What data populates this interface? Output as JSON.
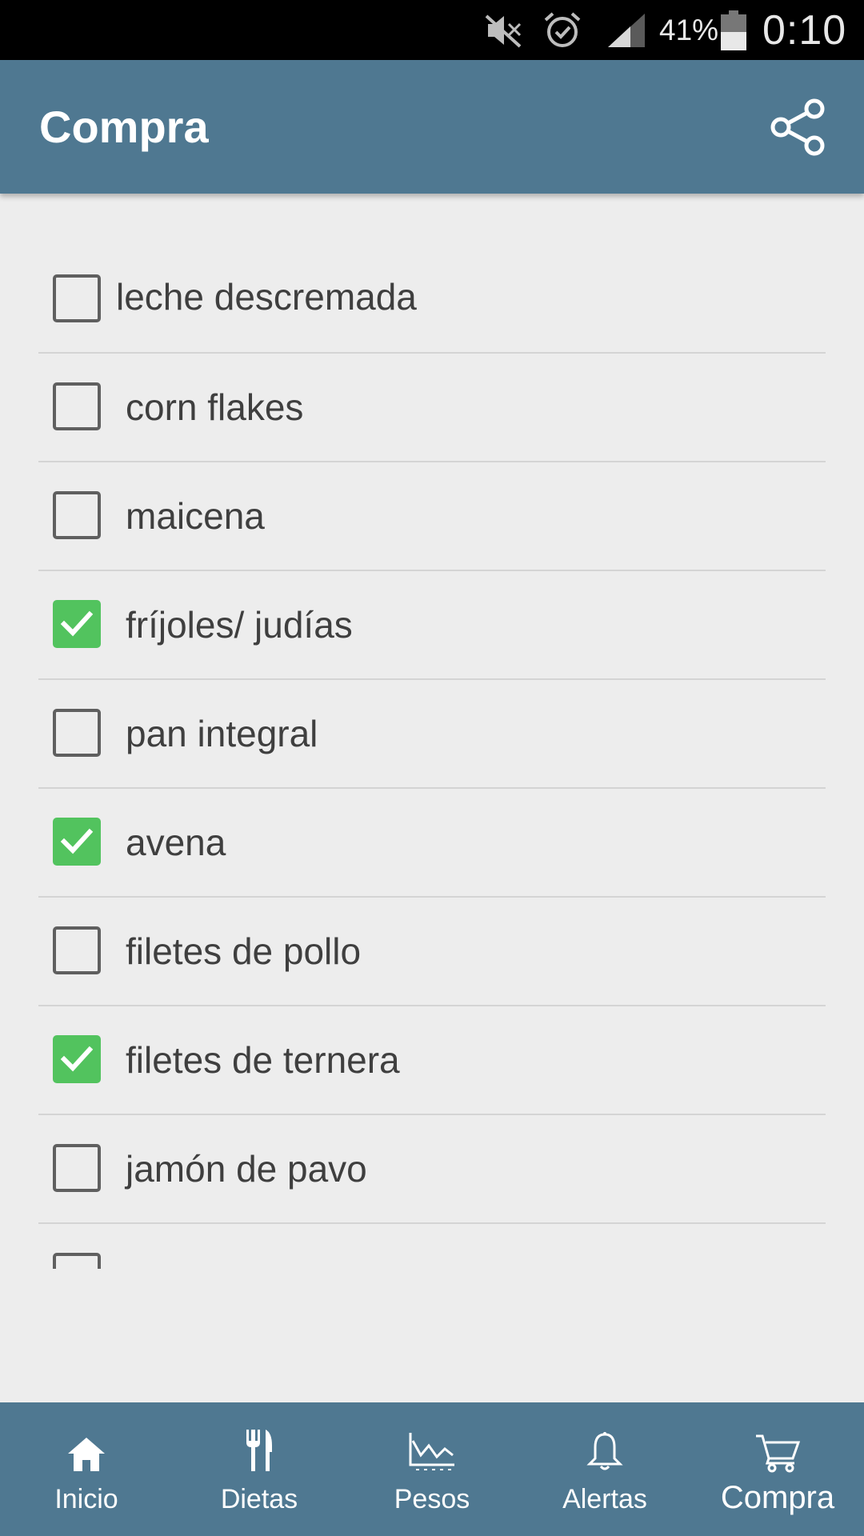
{
  "status_bar": {
    "battery_percent": "41%",
    "time": "0:10",
    "icons": [
      "mute-icon",
      "alarm-icon",
      "signal-icon",
      "battery-icon"
    ]
  },
  "app_bar": {
    "title": "Compra",
    "share_icon": "share-icon"
  },
  "shopping_list": {
    "items": [
      {
        "label": "leche descremada",
        "checked": false
      },
      {
        "label": "corn flakes",
        "checked": false
      },
      {
        "label": "maicena",
        "checked": false
      },
      {
        "label": "fríjoles/ judías",
        "checked": true
      },
      {
        "label": "pan integral",
        "checked": false
      },
      {
        "label": "avena",
        "checked": true
      },
      {
        "label": "filetes de pollo",
        "checked": false
      },
      {
        "label": "filetes de ternera",
        "checked": true
      },
      {
        "label": "jamón de pavo",
        "checked": false
      },
      {
        "label": "",
        "checked": false
      }
    ]
  },
  "bottom_nav": {
    "items": [
      {
        "label": "Inicio",
        "icon": "home-icon"
      },
      {
        "label": "Dietas",
        "icon": "fork-knife-icon"
      },
      {
        "label": "Pesos",
        "icon": "weight-chart-icon"
      },
      {
        "label": "Alertas",
        "icon": "bell-icon"
      },
      {
        "label": "Compra",
        "icon": "cart-icon",
        "active": true
      }
    ]
  },
  "colors": {
    "primary": "#4f7891",
    "checked": "#52c35e",
    "background": "#ededed"
  }
}
